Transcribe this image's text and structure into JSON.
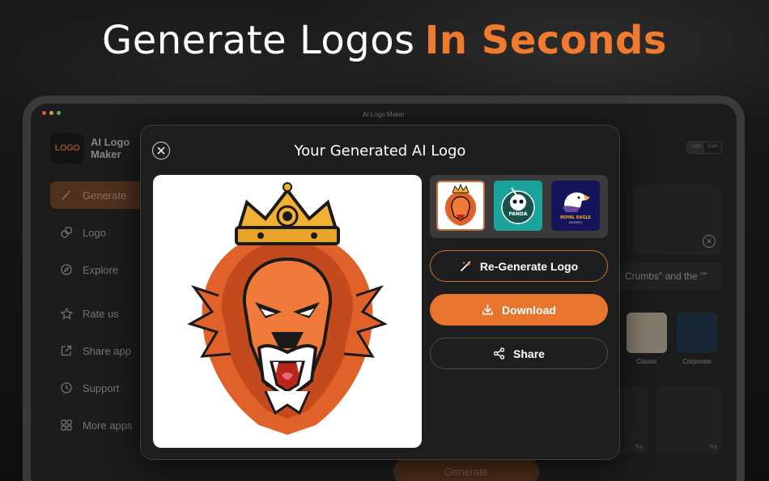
{
  "headline": {
    "text": "Generate Logos",
    "accent": "In Seconds"
  },
  "window": {
    "title": "AI Logo Maker"
  },
  "sidebar": {
    "brand_mark": "LOGO",
    "brand_name_1": "AI Logo",
    "brand_name_2": "Maker",
    "items": [
      {
        "label": "Generate",
        "icon": "magic-wand-icon"
      },
      {
        "label": "Logo",
        "icon": "shapes-icon"
      },
      {
        "label": "Explore",
        "icon": "compass-icon"
      },
      {
        "label": "Rate us",
        "icon": "star-icon"
      },
      {
        "label": "Share app",
        "icon": "share-out-icon"
      },
      {
        "label": "Support",
        "icon": "clock-icon"
      },
      {
        "label": "More apps",
        "icon": "grid-icon"
      }
    ]
  },
  "theme_toggle": {
    "light": "Light",
    "dark": "Dark"
  },
  "background": {
    "prompt_text": "Crumbs\" and the \"\"",
    "styles": [
      {
        "label": "Classic"
      },
      {
        "label": "Corporate"
      }
    ],
    "try_label": "Try",
    "generate_label": "Generate"
  },
  "modal": {
    "title": "Your Generated AI Logo",
    "regenerate_label": "Re-Generate Logo",
    "download_label": "Download",
    "share_label": "Share",
    "thumbnails": [
      {
        "name": "lion-logo",
        "bg": "#ffffff"
      },
      {
        "name": "panda-logo",
        "bg": "#1aa39a"
      },
      {
        "name": "eagle-logo",
        "bg": "#14145a"
      }
    ],
    "thumb_texts": {
      "panda": "PANDA",
      "eagle_1": "ROYAL EAGLE",
      "eagle_2": "ESPORTS"
    }
  },
  "colors": {
    "accent": "#e8752d",
    "modal_bg": "#1e1e1e",
    "page_bg": "#141414"
  }
}
